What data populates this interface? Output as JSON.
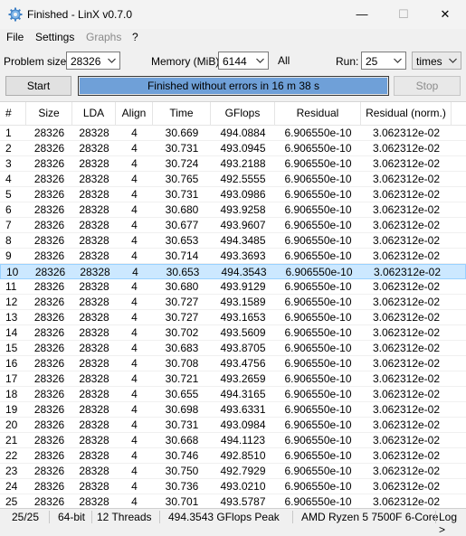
{
  "window": {
    "title": "Finished - LinX v0.7.0",
    "app_icon": "gear-icon"
  },
  "titlebar_buttons": {
    "minimize": "—",
    "maximize": "☐",
    "close": "✕"
  },
  "menu": [
    {
      "label": "File",
      "enabled": true
    },
    {
      "label": "Settings",
      "enabled": true
    },
    {
      "label": "Graphs",
      "enabled": false
    },
    {
      "label": "?",
      "enabled": true
    }
  ],
  "controls": {
    "problem_size_label": "Problem size:",
    "problem_size_value": "28326",
    "memory_label": "Memory (MiB):",
    "memory_value": "6144",
    "all_label": "All",
    "run_label": "Run:",
    "run_value": "25",
    "run_unit_value": "times",
    "start_label": "Start",
    "stop_label": "Stop",
    "progress_text": "Finished without errors in 16 m 38 s",
    "progress_fraction": 1.0
  },
  "table": {
    "columns": [
      "#",
      "Size",
      "LDA",
      "Align",
      "Time",
      "GFlops",
      "Residual",
      "Residual (norm.)"
    ],
    "selected_index": 9,
    "rows": [
      [
        "1",
        "28326",
        "28328",
        "4",
        "30.669",
        "494.0884",
        "6.906550e-10",
        "3.062312e-02"
      ],
      [
        "2",
        "28326",
        "28328",
        "4",
        "30.731",
        "493.0945",
        "6.906550e-10",
        "3.062312e-02"
      ],
      [
        "3",
        "28326",
        "28328",
        "4",
        "30.724",
        "493.2188",
        "6.906550e-10",
        "3.062312e-02"
      ],
      [
        "4",
        "28326",
        "28328",
        "4",
        "30.765",
        "492.5555",
        "6.906550e-10",
        "3.062312e-02"
      ],
      [
        "5",
        "28326",
        "28328",
        "4",
        "30.731",
        "493.0986",
        "6.906550e-10",
        "3.062312e-02"
      ],
      [
        "6",
        "28326",
        "28328",
        "4",
        "30.680",
        "493.9258",
        "6.906550e-10",
        "3.062312e-02"
      ],
      [
        "7",
        "28326",
        "28328",
        "4",
        "30.677",
        "493.9607",
        "6.906550e-10",
        "3.062312e-02"
      ],
      [
        "8",
        "28326",
        "28328",
        "4",
        "30.653",
        "494.3485",
        "6.906550e-10",
        "3.062312e-02"
      ],
      [
        "9",
        "28326",
        "28328",
        "4",
        "30.714",
        "493.3693",
        "6.906550e-10",
        "3.062312e-02"
      ],
      [
        "10",
        "28326",
        "28328",
        "4",
        "30.653",
        "494.3543",
        "6.906550e-10",
        "3.062312e-02"
      ],
      [
        "11",
        "28326",
        "28328",
        "4",
        "30.680",
        "493.9129",
        "6.906550e-10",
        "3.062312e-02"
      ],
      [
        "12",
        "28326",
        "28328",
        "4",
        "30.727",
        "493.1589",
        "6.906550e-10",
        "3.062312e-02"
      ],
      [
        "13",
        "28326",
        "28328",
        "4",
        "30.727",
        "493.1653",
        "6.906550e-10",
        "3.062312e-02"
      ],
      [
        "14",
        "28326",
        "28328",
        "4",
        "30.702",
        "493.5609",
        "6.906550e-10",
        "3.062312e-02"
      ],
      [
        "15",
        "28326",
        "28328",
        "4",
        "30.683",
        "493.8705",
        "6.906550e-10",
        "3.062312e-02"
      ],
      [
        "16",
        "28326",
        "28328",
        "4",
        "30.708",
        "493.4756",
        "6.906550e-10",
        "3.062312e-02"
      ],
      [
        "17",
        "28326",
        "28328",
        "4",
        "30.721",
        "493.2659",
        "6.906550e-10",
        "3.062312e-02"
      ],
      [
        "18",
        "28326",
        "28328",
        "4",
        "30.655",
        "494.3165",
        "6.906550e-10",
        "3.062312e-02"
      ],
      [
        "19",
        "28326",
        "28328",
        "4",
        "30.698",
        "493.6331",
        "6.906550e-10",
        "3.062312e-02"
      ],
      [
        "20",
        "28326",
        "28328",
        "4",
        "30.731",
        "493.0984",
        "6.906550e-10",
        "3.062312e-02"
      ],
      [
        "21",
        "28326",
        "28328",
        "4",
        "30.668",
        "494.1123",
        "6.906550e-10",
        "3.062312e-02"
      ],
      [
        "22",
        "28326",
        "28328",
        "4",
        "30.746",
        "492.8510",
        "6.906550e-10",
        "3.062312e-02"
      ],
      [
        "23",
        "28326",
        "28328",
        "4",
        "30.750",
        "492.7929",
        "6.906550e-10",
        "3.062312e-02"
      ],
      [
        "24",
        "28326",
        "28328",
        "4",
        "30.736",
        "493.0210",
        "6.906550e-10",
        "3.062312e-02"
      ],
      [
        "25",
        "28326",
        "28328",
        "4",
        "30.701",
        "493.5787",
        "6.906550e-10",
        "3.062312e-02"
      ]
    ]
  },
  "status": {
    "runs": "25/25",
    "bits": "64-bit",
    "threads": "12 Threads",
    "peak": "494.3543 GFlops Peak",
    "cpu": "AMD Ryzen 5 7500F 6-Core",
    "log": "Log >"
  },
  "colors": {
    "selected_row": "#cce8ff",
    "progress_fill": "#6fa0d8"
  }
}
